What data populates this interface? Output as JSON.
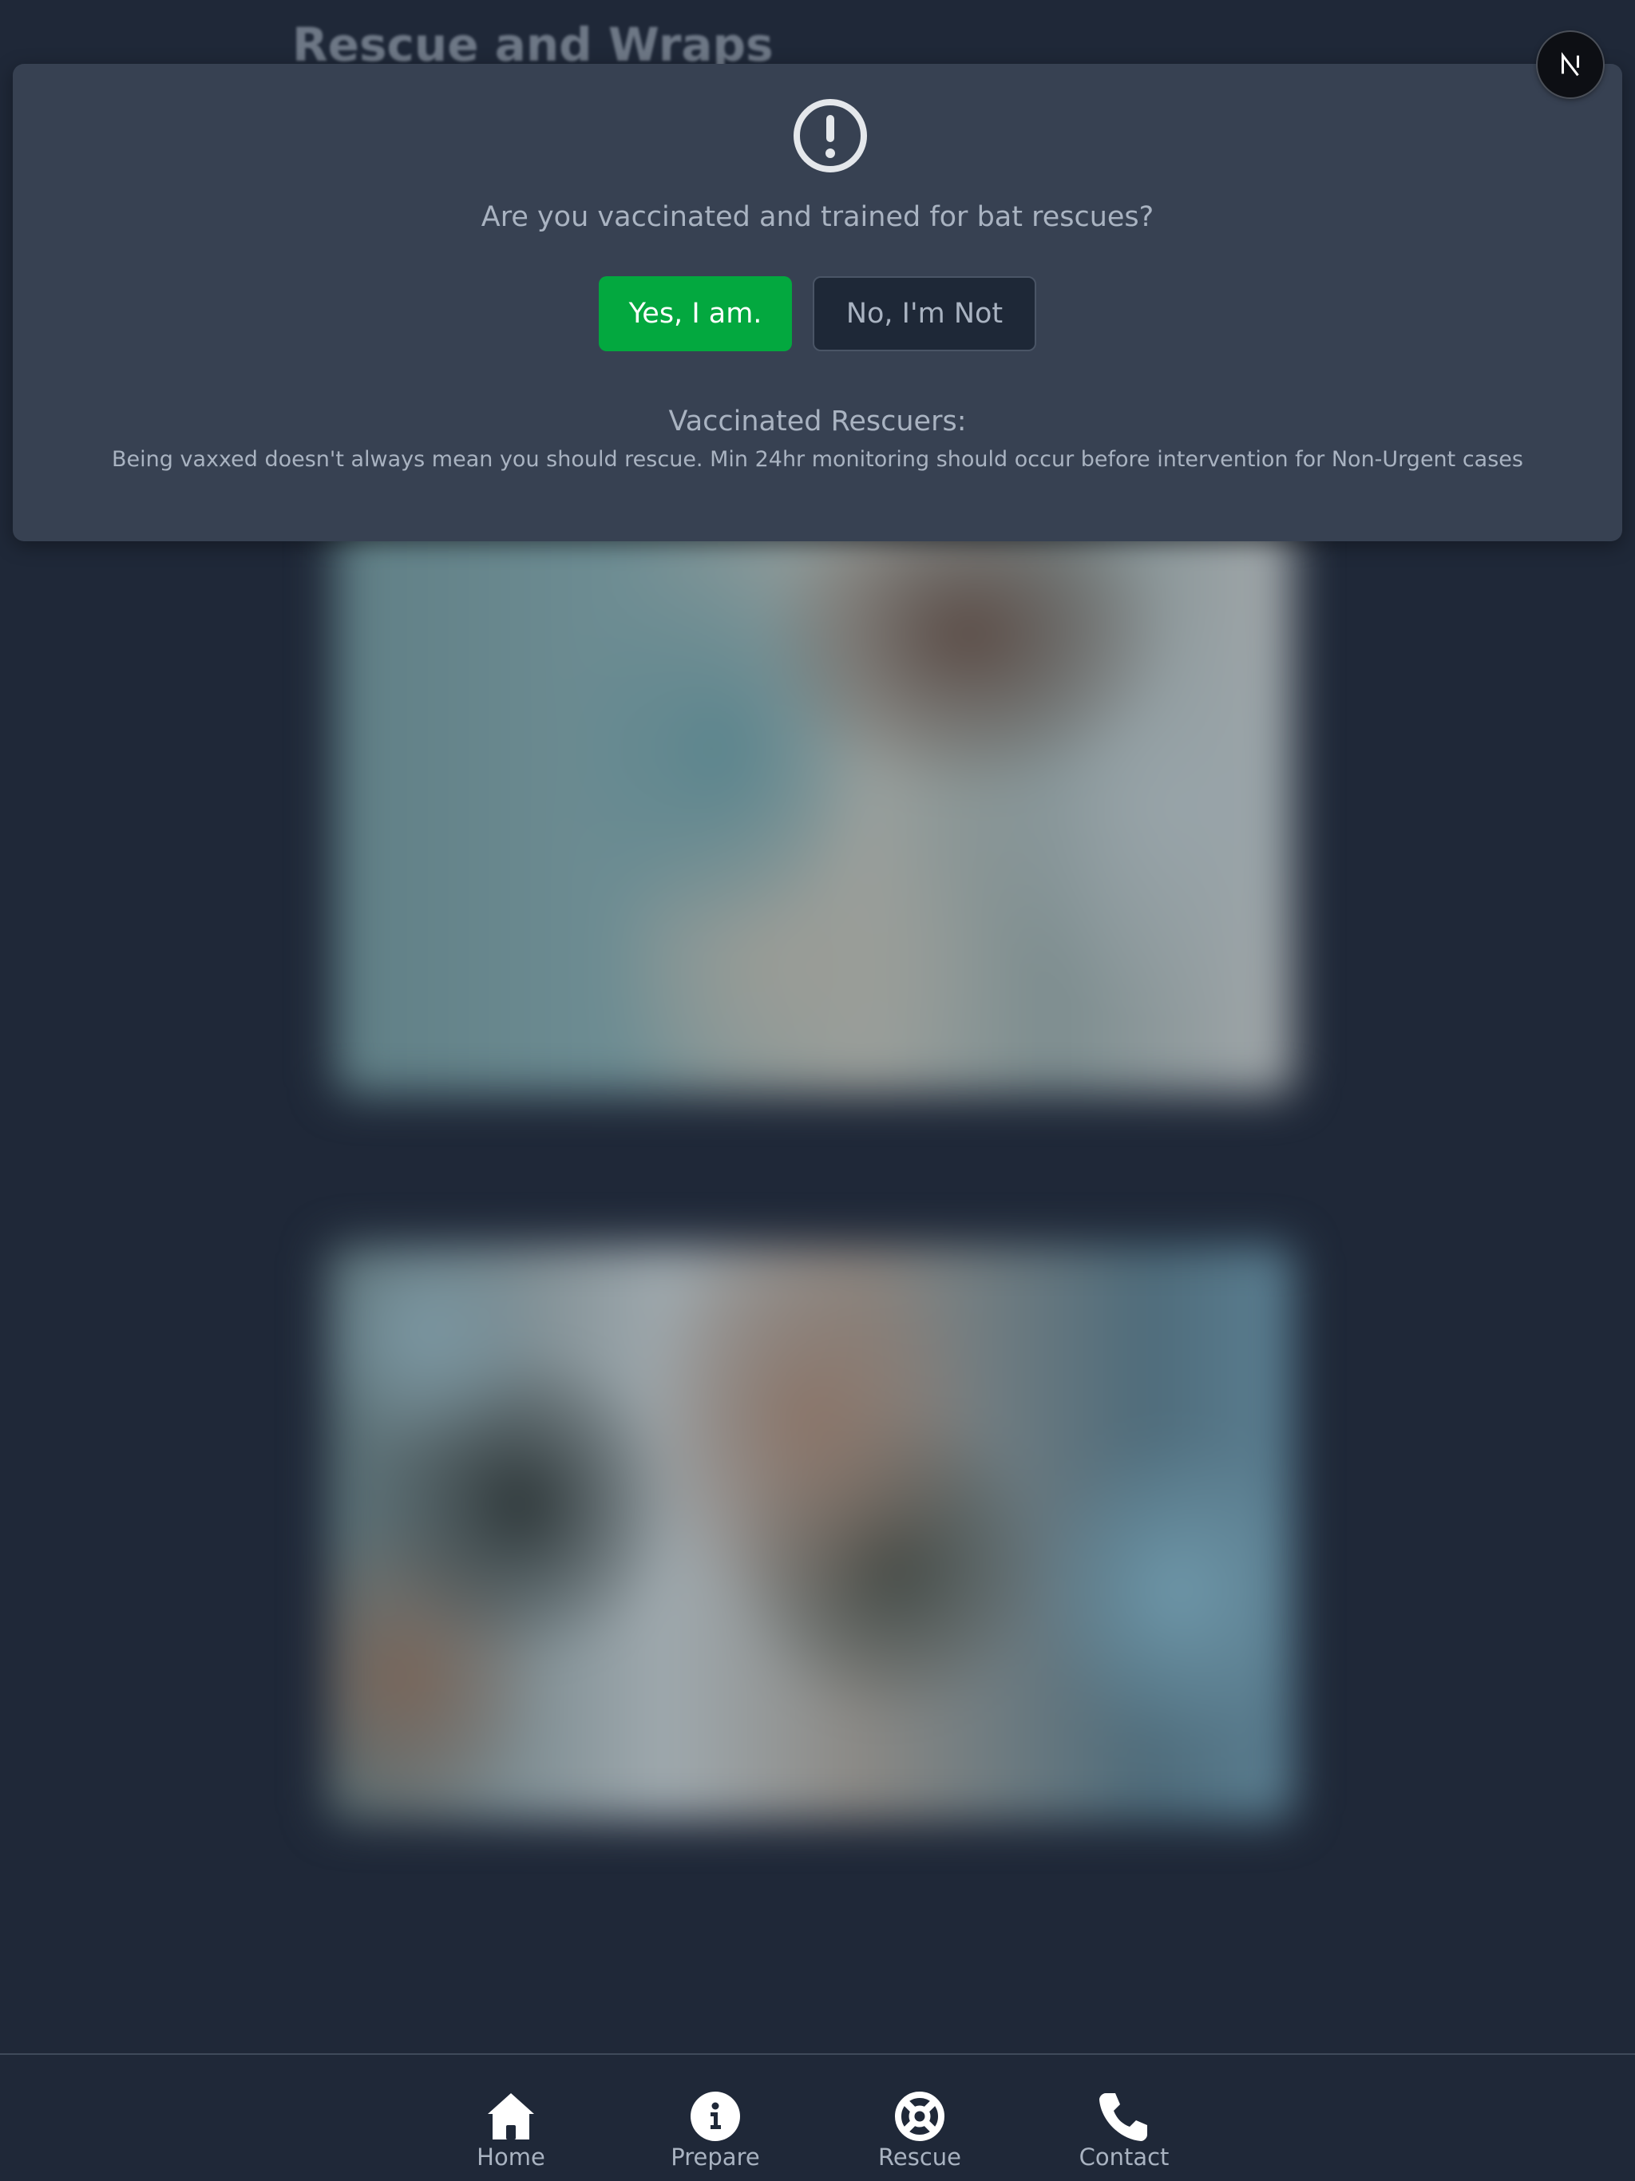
{
  "page": {
    "title": "Rescue and Wraps"
  },
  "modal": {
    "icon": "exclamation-circle-icon",
    "question": "Are you vaccinated and trained for bat rescues?",
    "yes_label": "Yes, I am.",
    "no_label": "No, I'm Not",
    "info_title": "Vaccinated Rescuers:",
    "info_text": "Being vaxxed doesn't always mean you should rescue. Min 24hr monitoring should occur before intervention for Non-Urgent cases"
  },
  "avatar": {
    "letter": "N",
    "icon": "nextjs-logo-icon"
  },
  "nav": {
    "items": [
      {
        "label": "Home",
        "icon": "home-icon"
      },
      {
        "label": "Prepare",
        "icon": "info-icon"
      },
      {
        "label": "Rescue",
        "icon": "lifebuoy-icon"
      },
      {
        "label": "Contact",
        "icon": "phone-icon"
      }
    ]
  },
  "colors": {
    "background": "#1f2838",
    "modal": "#374152",
    "accent_green": "#03a83f",
    "text_muted": "#a9b3c1"
  }
}
